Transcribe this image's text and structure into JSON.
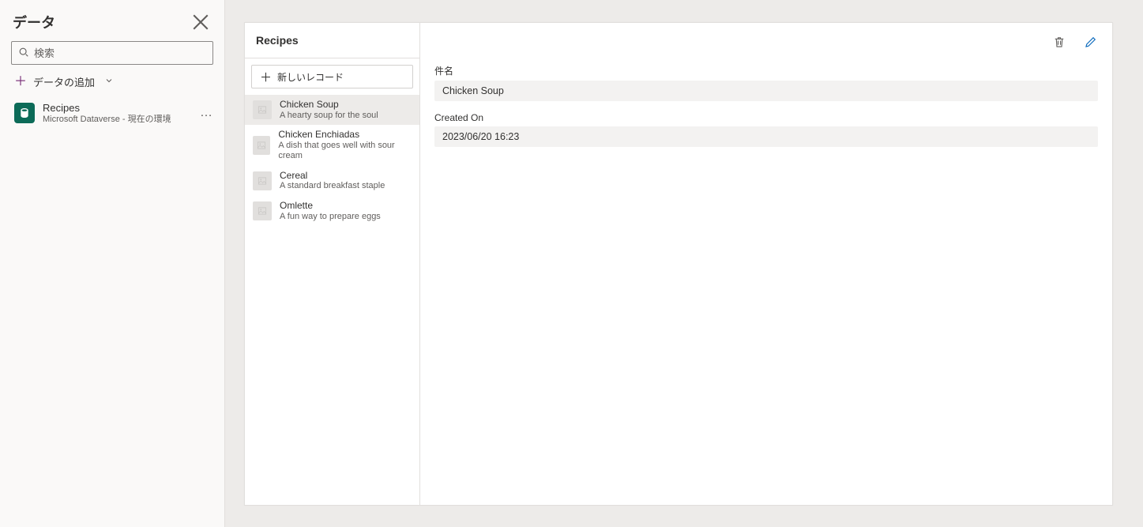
{
  "sidebar": {
    "title": "データ",
    "search_placeholder": "検索",
    "add_data_label": "データの追加",
    "data_source": {
      "name": "Recipes",
      "subtitle": "Microsoft Dataverse - 現在の環境"
    }
  },
  "list": {
    "header": "Recipes",
    "new_record_label": "新しいレコード",
    "records": [
      {
        "title": "Chicken Soup",
        "subtitle": "A hearty soup for the soul",
        "selected": true
      },
      {
        "title": "Chicken Enchiadas",
        "subtitle": "A dish that goes well with sour cream",
        "selected": false
      },
      {
        "title": "Cereal",
        "subtitle": "A standard breakfast staple",
        "selected": false
      },
      {
        "title": "Omlette",
        "subtitle": "A fun way to prepare eggs",
        "selected": false
      }
    ]
  },
  "detail": {
    "fields": [
      {
        "label": "件名",
        "value": "Chicken Soup"
      },
      {
        "label": "Created On",
        "value": "2023/06/20 16:23"
      }
    ]
  }
}
